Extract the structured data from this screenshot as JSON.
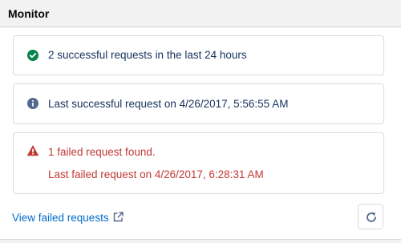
{
  "header": {
    "title": "Monitor"
  },
  "cards": [
    {
      "icon": "success-check-icon",
      "text": "2 successful requests in the last 24 hours"
    },
    {
      "icon": "info-icon",
      "text": "Last successful request on 4/26/2017, 5:56:55 AM"
    },
    {
      "icon": "warning-icon",
      "line1": "1 failed request found.",
      "line2": "Last failed request on 4/26/2017, 6:28:31 AM"
    }
  ],
  "footer": {
    "link_label": "View failed requests",
    "link_icon": "external-link-icon",
    "refresh_icon": "refresh-icon"
  },
  "colors": {
    "success": "#04844b",
    "info": "#54698d",
    "error": "#c23934",
    "link": "#006dcc",
    "text": "#16325c"
  }
}
